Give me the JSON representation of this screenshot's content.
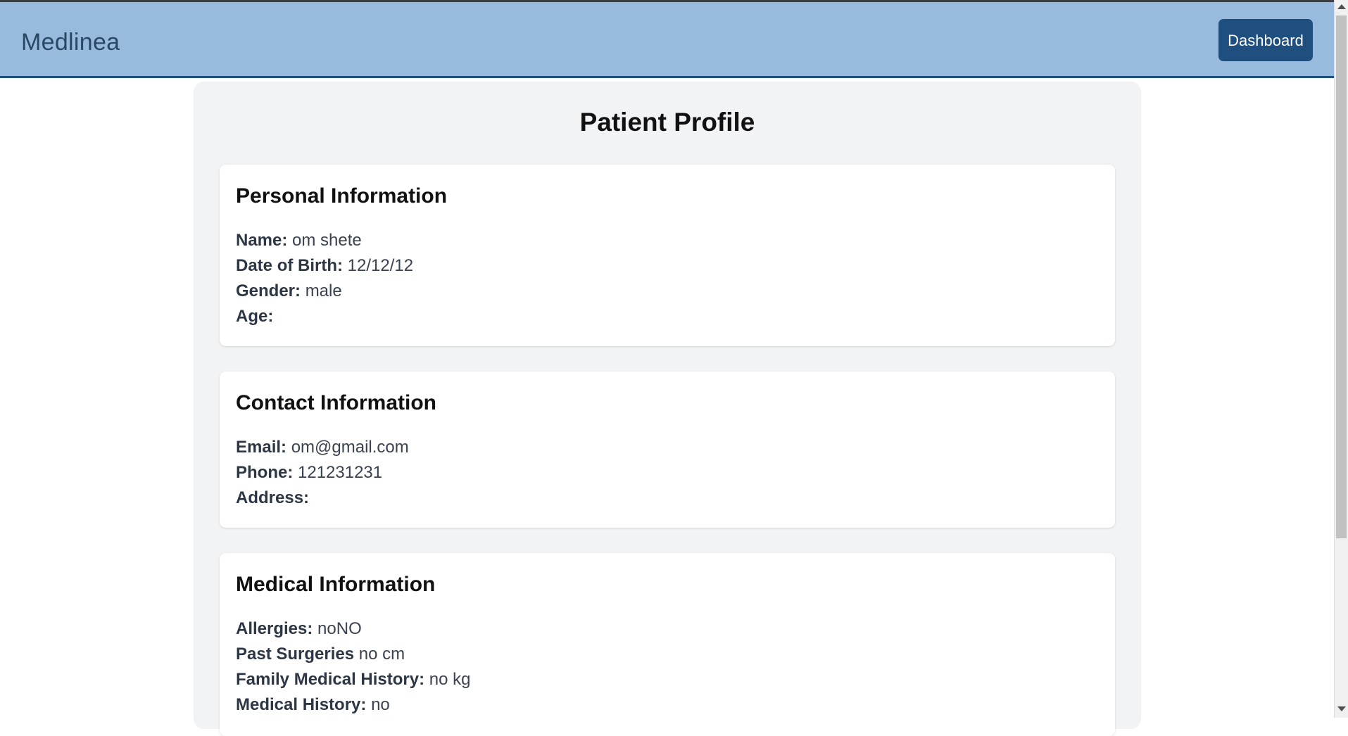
{
  "navbar": {
    "brand": "Medlinea",
    "dashboard_label": "Dashboard"
  },
  "page": {
    "title": "Patient Profile"
  },
  "personal": {
    "heading": "Personal Information",
    "name_label": "Name:",
    "name_value": "om shete",
    "dob_label": "Date of Birth:",
    "dob_value": "12/12/12",
    "gender_label": "Gender:",
    "gender_value": "male",
    "age_label": "Age:",
    "age_value": ""
  },
  "contact": {
    "heading": "Contact Information",
    "email_label": "Email:",
    "email_value": "om@gmail.com",
    "phone_label": "Phone:",
    "phone_value": "121231231",
    "address_label": "Address:",
    "address_value": ""
  },
  "medical": {
    "heading": "Medical Information",
    "allergies_label": "Allergies:",
    "allergies_value": "noNO",
    "surgeries_label": "Past Surgeries",
    "surgeries_value": "no cm",
    "family_label": "Family Medical History:",
    "family_value": "no kg",
    "history_label": "Medical History:",
    "history_value": "no"
  },
  "colors": {
    "navbar_bg": "#98bbdd",
    "navbar_border": "#1f4f7e",
    "button_bg": "#1f4f7e",
    "container_bg": "#f2f3f5",
    "card_bg": "#ffffff"
  }
}
